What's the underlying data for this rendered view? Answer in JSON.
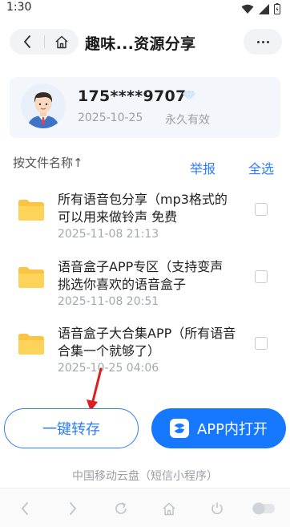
{
  "status_bar": {
    "time": "1:30"
  },
  "nav": {
    "title": "趣味...资源分享"
  },
  "share": {
    "user": "175****9707",
    "date": "2025-10-25",
    "validity": "永久有效"
  },
  "toolbar": {
    "sort_label": "按文件名称↑",
    "report": "举报",
    "select_all": "全选"
  },
  "files": [
    {
      "name": "所有语音包分享（mp3格式的可以用来做铃声 免费",
      "time": "2025-11-08 21:13"
    },
    {
      "name": "语音盒子APP专区（支持变声 挑选你喜欢的语音盒子",
      "time": "2025-11-08 20:51"
    },
    {
      "name": "语音盒子大合集APP（所有语音合集一个就够了）",
      "time": "2025-10-25 04:06"
    }
  ],
  "actions": {
    "save": "一键转存",
    "open_app": "APP内打开"
  },
  "footer": {
    "brand": "中国移动云盘（短信小程序）"
  },
  "colors": {
    "accent": "#2d7df6",
    "primary_button": "#1677ff",
    "folder": "#fbc442"
  },
  "icons": [
    "back-arrow-icon",
    "home-icon",
    "more-dots-icon",
    "vip-diamond-icon",
    "folder-icon",
    "checkbox-icon",
    "cloud-logo-icon",
    "browser-back-icon",
    "browser-forward-icon",
    "refresh-icon",
    "browser-home-icon",
    "power-icon",
    "toggle-icon"
  ]
}
